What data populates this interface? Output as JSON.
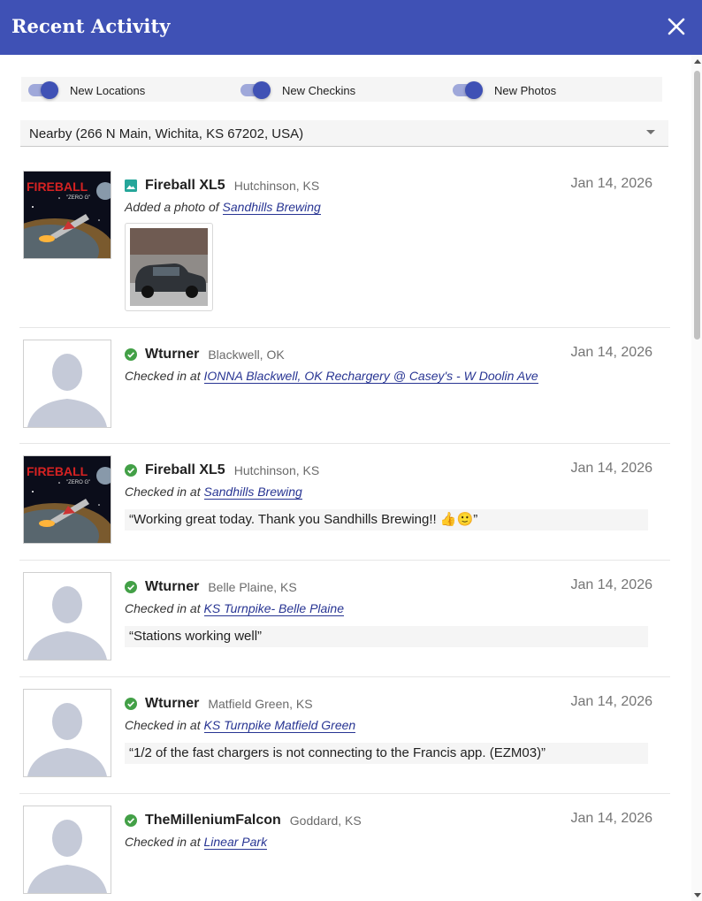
{
  "header": {
    "title": "Recent Activity",
    "close_icon": "close-icon"
  },
  "filters": [
    {
      "label": "New Locations",
      "checked": true
    },
    {
      "label": "New Checkins",
      "checked": true
    },
    {
      "label": "New Photos",
      "checked": true
    }
  ],
  "location_select": {
    "value": "Nearby (266 N Main, Wichita, KS 67202, USA)"
  },
  "colors": {
    "primary": "#3f51b5",
    "checkin_icon": "#43a047",
    "photo_icon": "#26a69a",
    "link": "#283593"
  },
  "activities": [
    {
      "type": "photo",
      "icon": "image-icon",
      "avatar": "fireball-avatar",
      "user": "Fireball XL5",
      "location": "Hutchinson, KS",
      "date": "Jan 14, 2026",
      "action": "Added a photo of",
      "place": "Sandhills Brewing",
      "comment": ""
    },
    {
      "type": "checkin",
      "icon": "check-circle-icon",
      "avatar": "default-avatar",
      "user": "Wturner",
      "location": "Blackwell, OK",
      "date": "Jan 14, 2026",
      "action": "Checked in at",
      "place": "IONNA Blackwell, OK Rechargery @ Casey's - W Doolin Ave",
      "comment": ""
    },
    {
      "type": "checkin",
      "icon": "check-circle-icon",
      "avatar": "fireball-avatar",
      "user": "Fireball XL5",
      "location": "Hutchinson, KS",
      "date": "Jan 14, 2026",
      "action": "Checked in at",
      "place": "Sandhills Brewing",
      "comment": "“Working great today. Thank you Sandhills Brewing!! 👍🙂”"
    },
    {
      "type": "checkin",
      "icon": "check-circle-icon",
      "avatar": "default-avatar",
      "user": "Wturner",
      "location": "Belle Plaine, KS",
      "date": "Jan 14, 2026",
      "action": "Checked in at",
      "place": "KS Turnpike- Belle Plaine",
      "comment": "“Stations working well”"
    },
    {
      "type": "checkin",
      "icon": "check-circle-icon",
      "avatar": "default-avatar",
      "user": "Wturner",
      "location": "Matfield Green, KS",
      "date": "Jan 14, 2026",
      "action": "Checked in at",
      "place": "KS Turnpike Matfield Green",
      "comment": "“1/2 of the fast chargers is not connecting to the Francis app. (EZM03)”"
    },
    {
      "type": "checkin",
      "icon": "check-circle-icon",
      "avatar": "default-avatar",
      "user": "TheMilleniumFalcon",
      "location": "Goddard, KS",
      "date": "Jan 14, 2026",
      "action": "Checked in at",
      "place": "Linear Park",
      "comment": ""
    }
  ]
}
